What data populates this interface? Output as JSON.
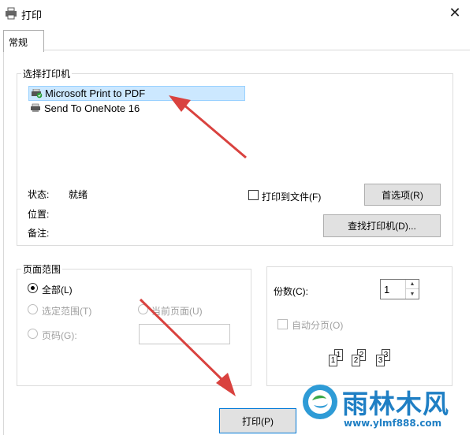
{
  "window": {
    "title": "打印",
    "close_glyph": "✕"
  },
  "tabs": [
    {
      "label": "常规"
    }
  ],
  "printer_group": {
    "legend": "选择打印机",
    "printers": [
      {
        "name": "Microsoft Print to PDF",
        "selected": true
      },
      {
        "name": "Send To OneNote 16",
        "selected": false
      }
    ],
    "status_label": "状态:",
    "status_value": "就绪",
    "location_label": "位置:",
    "comment_label": "备注:",
    "print_to_file_label": "打印到文件(F)",
    "preferences_button": "首选项(R)",
    "find_printer_button": "查找打印机(D)..."
  },
  "page_range_group": {
    "legend": "页面范围",
    "all_label": "全部(L)",
    "selection_label": "选定范围(T)",
    "current_page_label": "当前页面(U)",
    "pages_label": "页码(G):"
  },
  "copies_group": {
    "copies_label": "份数(C):",
    "copies_value": "1",
    "collate_label": "自动分页(O)",
    "collate_numbers": [
      "1",
      "1",
      "2",
      "2",
      "3",
      "3"
    ]
  },
  "footer": {
    "print_button": "打印(P)"
  },
  "watermark": {
    "name": "雨林木风",
    "url": "www.ylmf888.com"
  },
  "colors": {
    "selection_bg": "#cce8ff",
    "arrow": "#d9423f",
    "brand": "#1f7fc4"
  }
}
